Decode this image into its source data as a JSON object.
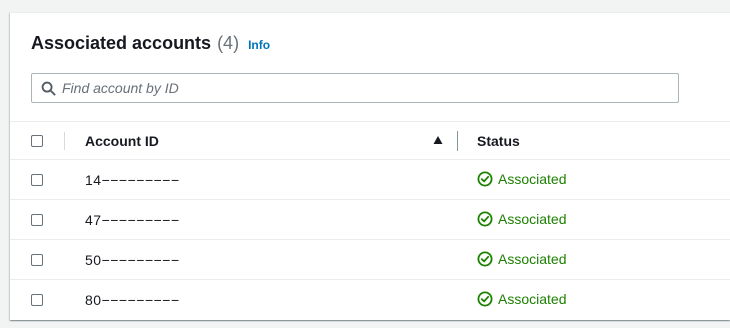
{
  "header": {
    "title": "Associated accounts",
    "count": "(4)",
    "info_label": "Info"
  },
  "search": {
    "placeholder": "Find account by ID",
    "value": ""
  },
  "table": {
    "columns": {
      "account_id": "Account ID",
      "status": "Status"
    },
    "sort": {
      "column": "Account ID",
      "direction": "ascending"
    },
    "rows": [
      {
        "account_id": "14−−−−−−−−−",
        "status": "Associated"
      },
      {
        "account_id": "47−−−−−−−−−",
        "status": "Associated"
      },
      {
        "account_id": "50−−−−−−−−−",
        "status": "Associated"
      },
      {
        "account_id": "80−−−−−−−−−",
        "status": "Associated"
      }
    ]
  },
  "colors": {
    "accent_link": "#0073bb",
    "status_success": "#1d8102",
    "text_primary": "#16191f",
    "text_secondary": "#687078",
    "border": "#eaeded"
  },
  "icons": {
    "search": "search-icon",
    "sort": "sort-ascending-icon",
    "status": "check-circle-icon"
  }
}
